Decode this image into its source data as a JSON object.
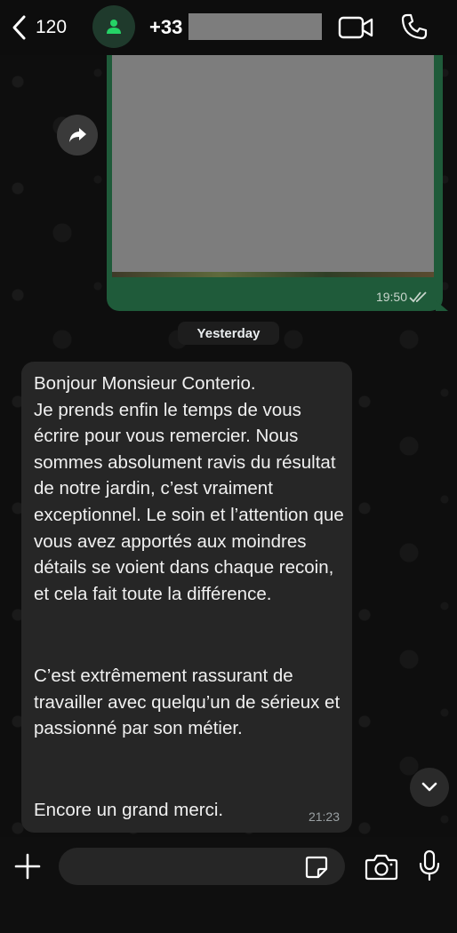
{
  "header": {
    "back_count": "120",
    "contact_prefix": "+33"
  },
  "messages": {
    "outgoing_time": "19:50",
    "date_separator": "Yesterday",
    "incoming": {
      "paragraph_1": "Bonjour Monsieur Conterio.\nJe prends enfin le temps de vous écrire pour vous remercier. Nous sommes absolument ravis du résultat de notre jardin, c’est vraiment exceptionnel. Le soin et l’attention que vous avez apportés aux moindres détails se voient dans chaque recoin, et cela fait toute la différence.",
      "paragraph_2": "C’est extrêmement rassurant de travailler avec quelqu’un de sérieux et passionné par son métier.",
      "paragraph_3": "Encore un grand merci.",
      "time": "21:23"
    }
  },
  "input": {
    "placeholder": ""
  },
  "colors": {
    "outgoing_bubble": "#1f5b3a",
    "incoming_bubble": "#262626",
    "accent": "#25d366"
  },
  "icons": {
    "back": "chevron-left-icon",
    "avatar": "person-icon",
    "video": "video-camera-icon",
    "call": "phone-icon",
    "forward": "forward-icon",
    "scroll_down": "chevron-down-icon",
    "plus": "plus-icon",
    "sticker": "sticker-icon",
    "camera": "camera-icon",
    "mic": "microphone-icon"
  }
}
